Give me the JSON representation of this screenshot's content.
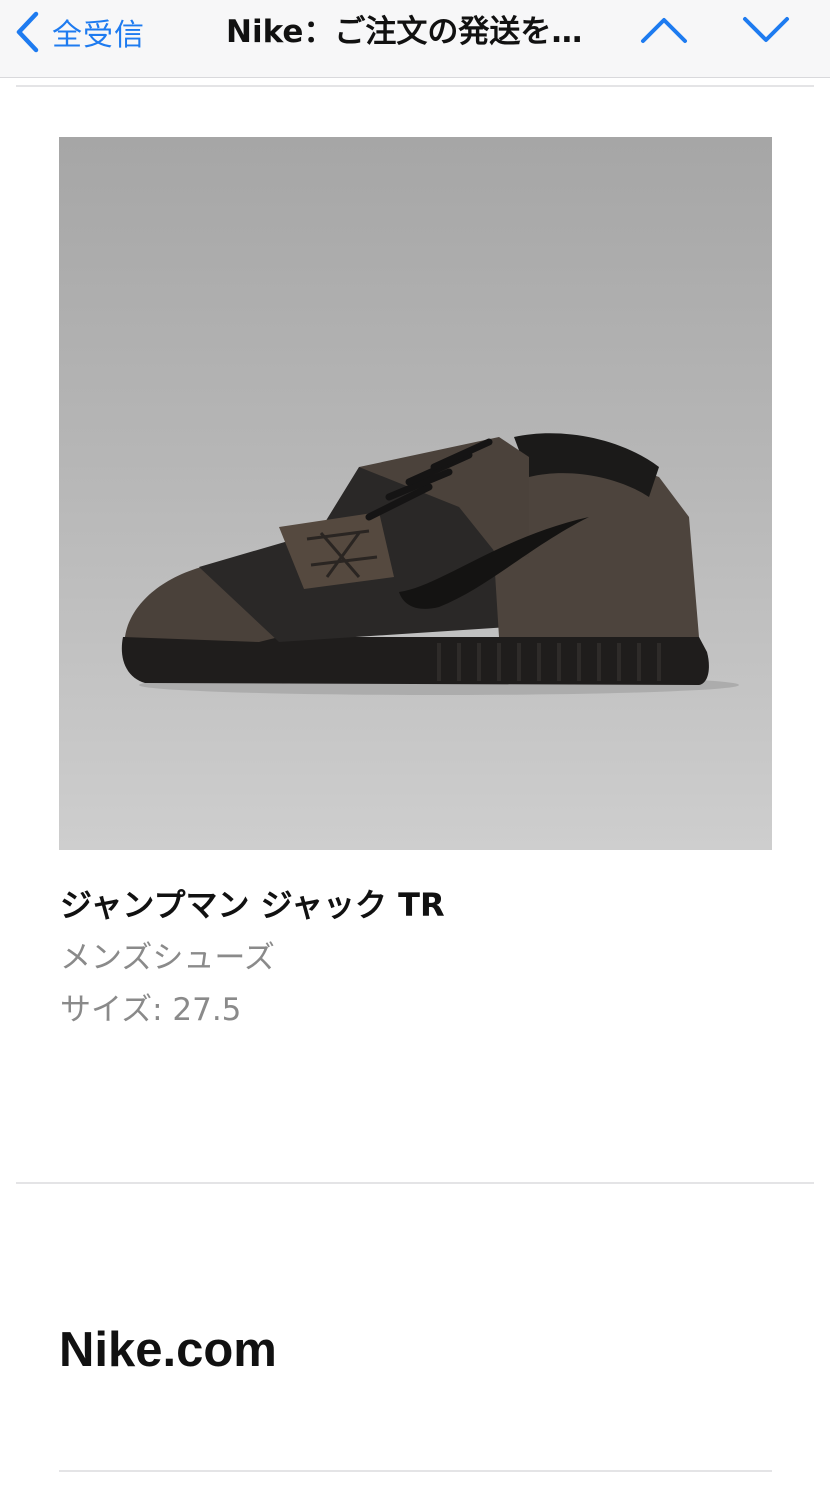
{
  "navbar": {
    "back_label": "全受信",
    "title": "Nike：ご注文の発送を…",
    "icons": {
      "back": "chevron-left-icon",
      "previous": "chevron-up-icon",
      "next": "chevron-down-icon"
    },
    "accent_color": "#1e7bf0"
  },
  "product": {
    "name": "ジャンプマン ジャック TR",
    "category": "メンズシューズ",
    "size_label": "サイズ:",
    "size_value": "27.5",
    "image_subject": "shoe"
  },
  "footer": {
    "brand": "Nike.com"
  },
  "colors": {
    "text_primary": "#111111",
    "text_secondary": "#8a8a8a",
    "separator": "#e4e4e6"
  }
}
